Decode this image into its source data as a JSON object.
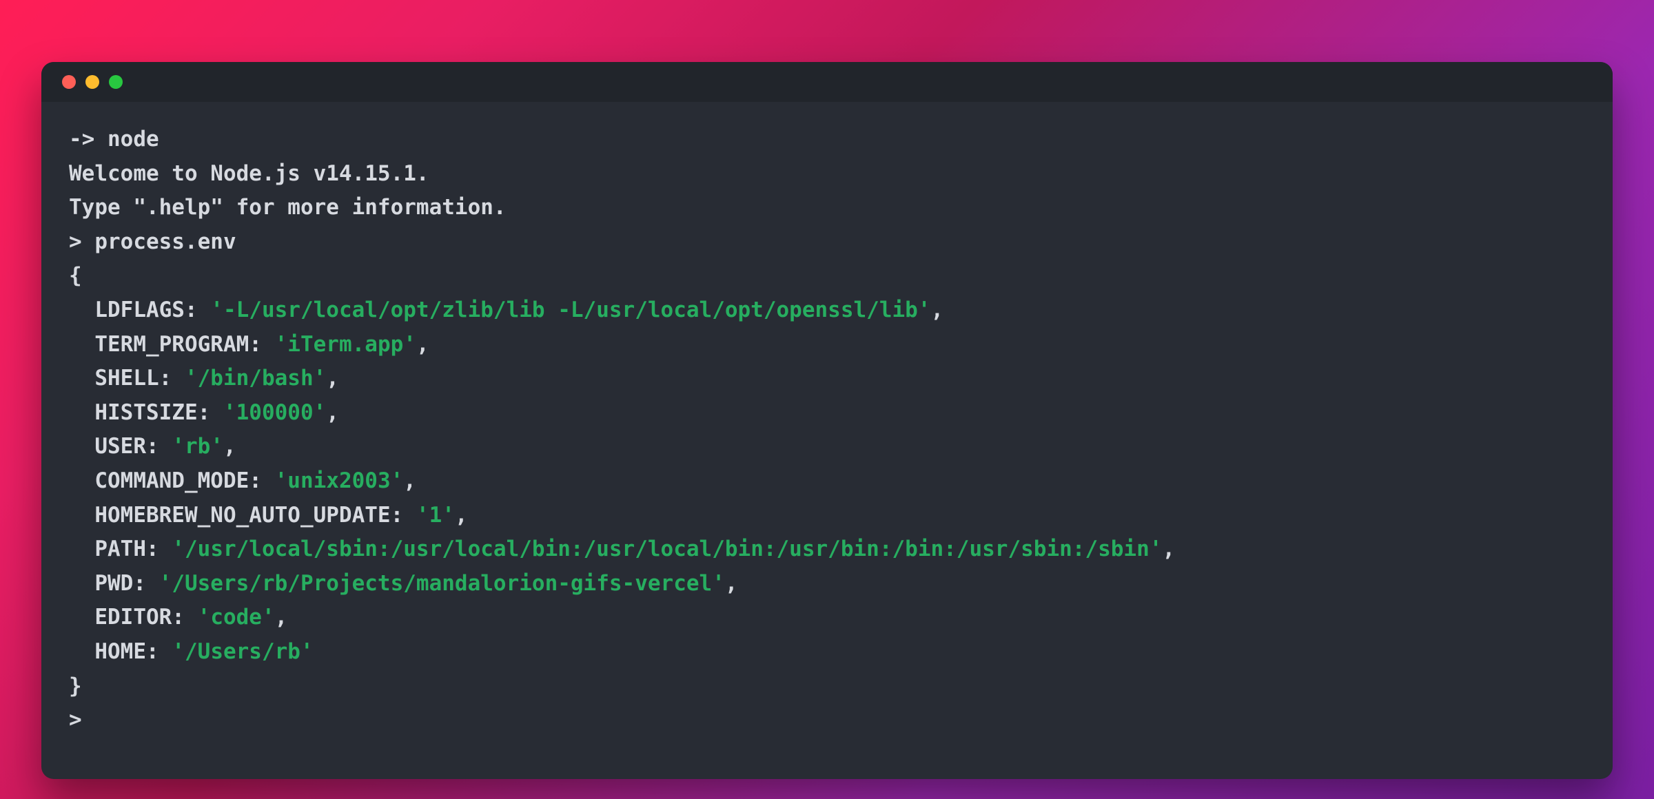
{
  "shell": {
    "prompt": "-> ",
    "command": "node"
  },
  "welcome": {
    "line1": "Welcome to Node.js v14.15.1.",
    "line2": "Type \".help\" for more information."
  },
  "repl": {
    "prompt": "> ",
    "input": "process.env",
    "open_brace": "{",
    "close_brace": "}",
    "trailing_prompt": "> "
  },
  "env": [
    {
      "key": "LDFLAGS",
      "value": "'-L/usr/local/opt/zlib/lib -L/usr/local/opt/openssl/lib'"
    },
    {
      "key": "TERM_PROGRAM",
      "value": "'iTerm.app'"
    },
    {
      "key": "SHELL",
      "value": "'/bin/bash'"
    },
    {
      "key": "HISTSIZE",
      "value": "'100000'"
    },
    {
      "key": "USER",
      "value": "'rb'"
    },
    {
      "key": "COMMAND_MODE",
      "value": "'unix2003'"
    },
    {
      "key": "HOMEBREW_NO_AUTO_UPDATE",
      "value": "'1'"
    },
    {
      "key": "PATH",
      "value": "'/usr/local/sbin:/usr/local/bin:/usr/local/bin:/usr/bin:/bin:/usr/sbin:/sbin'"
    },
    {
      "key": "PWD",
      "value": "'/Users/rb/Projects/mandalorion-gifs-vercel'"
    },
    {
      "key": "EDITOR",
      "value": "'code'"
    },
    {
      "key": "HOME",
      "value": "'/Users/rb'"
    }
  ],
  "colors": {
    "string_green": "#27ae60",
    "text_light": "#d7dae0",
    "bg_terminal": "#282c34",
    "bg_titlebar": "#21252b"
  }
}
